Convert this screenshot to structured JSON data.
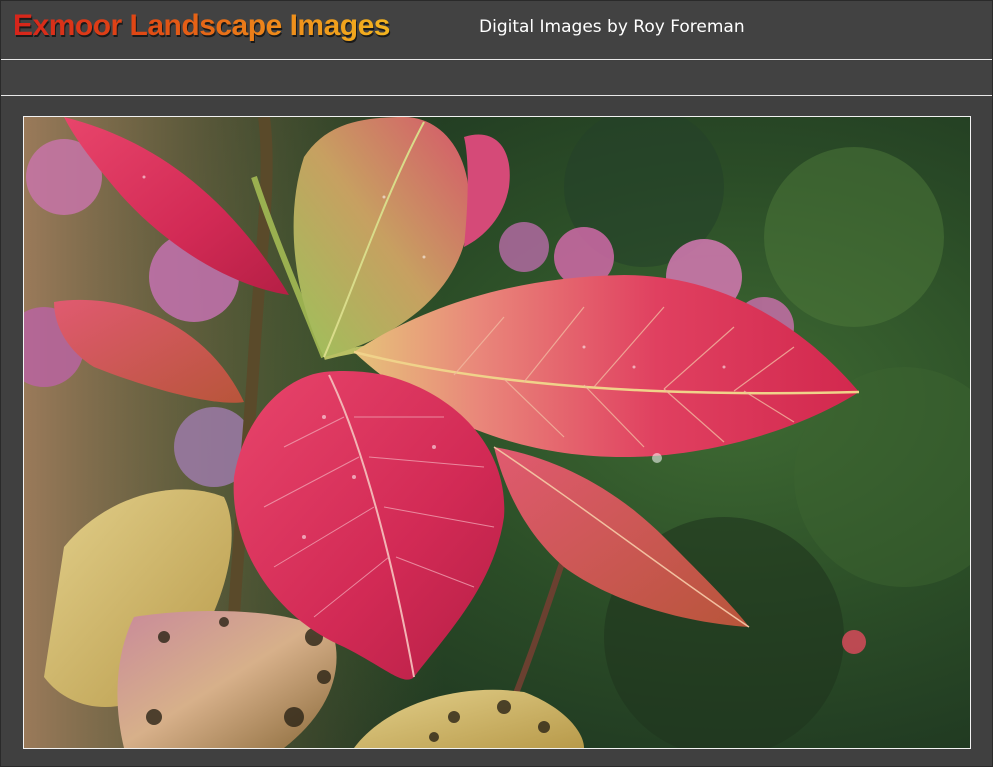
{
  "header": {
    "site_title": "Exmoor Landscape Images",
    "subtitle": "Digital Images by Roy Foreman"
  },
  "navbar": {
    "items": []
  },
  "photo": {
    "subject": "Red hydrangea leaves with raindrops"
  },
  "colors": {
    "background": "#404040",
    "divider": "#e8e8e8",
    "title_gradient_start": "#d7241b",
    "title_gradient_end": "#f3b41f",
    "subtitle": "#ffffff"
  }
}
